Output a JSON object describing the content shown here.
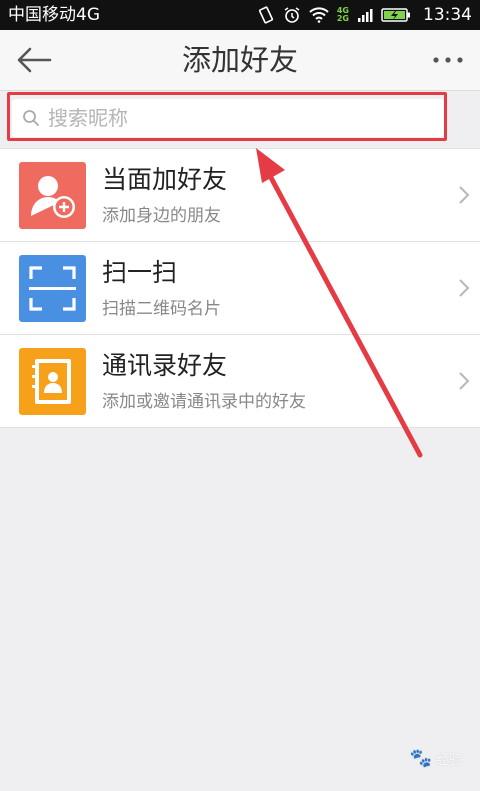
{
  "status_bar": {
    "carrier": "中国移动4G",
    "net_top": "4G",
    "net_bottom": "2G",
    "time": "13:34"
  },
  "nav": {
    "title": "添加好友",
    "back_icon": "back-arrow-icon",
    "more_icon": "more-dots-icon"
  },
  "search": {
    "placeholder": "搜索昵称",
    "icon": "search-icon"
  },
  "list": [
    {
      "title": "当面加好友",
      "subtitle": "添加身边的朋友",
      "icon": "add-person-icon",
      "color": "#ef6a5f"
    },
    {
      "title": "扫一扫",
      "subtitle": "扫描二维码名片",
      "icon": "scan-icon",
      "color": "#4a90e2"
    },
    {
      "title": "通讯录好友",
      "subtitle": "添加或邀请通讯录中的好友",
      "icon": "contacts-book-icon",
      "color": "#f7a01a"
    }
  ],
  "colors": {
    "annotation_red": "#e53b44",
    "background": "#efeff1",
    "nav_bg": "#f7f7f7"
  },
  "watermark": {
    "text": "经验",
    "logo": "baidu-paw-icon"
  }
}
